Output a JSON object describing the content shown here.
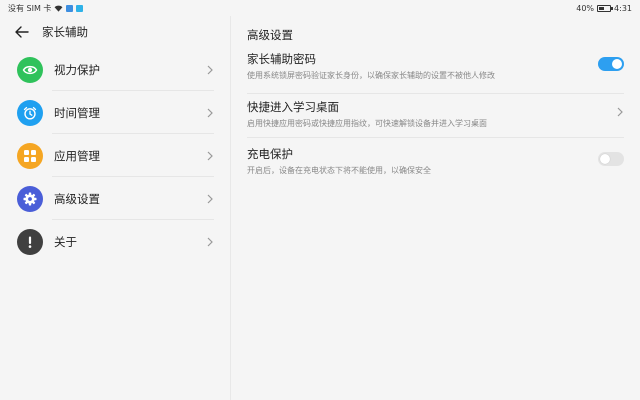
{
  "status_bar": {
    "carrier": "没有 SIM 卡",
    "battery": "40%",
    "time": "4:31"
  },
  "header": {
    "title": "家长辅助"
  },
  "menu": {
    "items": [
      {
        "label": "视力保护",
        "icon": "eye-icon",
        "color": "#2fc25b"
      },
      {
        "label": "时间管理",
        "icon": "alarm-clock-icon",
        "color": "#1fa0f0"
      },
      {
        "label": "应用管理",
        "icon": "apps-grid-icon",
        "color": "#f5a623"
      },
      {
        "label": "高级设置",
        "icon": "gear-icon",
        "color": "#4a5ed8"
      },
      {
        "label": "关于",
        "icon": "info-exclamation-icon",
        "color": "#404040"
      }
    ]
  },
  "advanced": {
    "title": "高级设置",
    "settings": [
      {
        "title": "家长辅助密码",
        "desc": "使用系统锁屏密码验证家长身份，以确保家长辅助的设置不被他人修改",
        "control": "toggle",
        "on": true
      },
      {
        "title": "快捷进入学习桌面",
        "desc": "启用快捷应用密码或快捷应用指纹，可快速解锁设备并进入学习桌面",
        "control": "chevron"
      },
      {
        "title": "充电保护",
        "desc": "开启后，设备在充电状态下将不能使用，以确保安全",
        "control": "toggle",
        "on": false
      }
    ]
  },
  "colors": {
    "accent": "#2d9ff0",
    "toggle_off": "#e3e3e3"
  }
}
